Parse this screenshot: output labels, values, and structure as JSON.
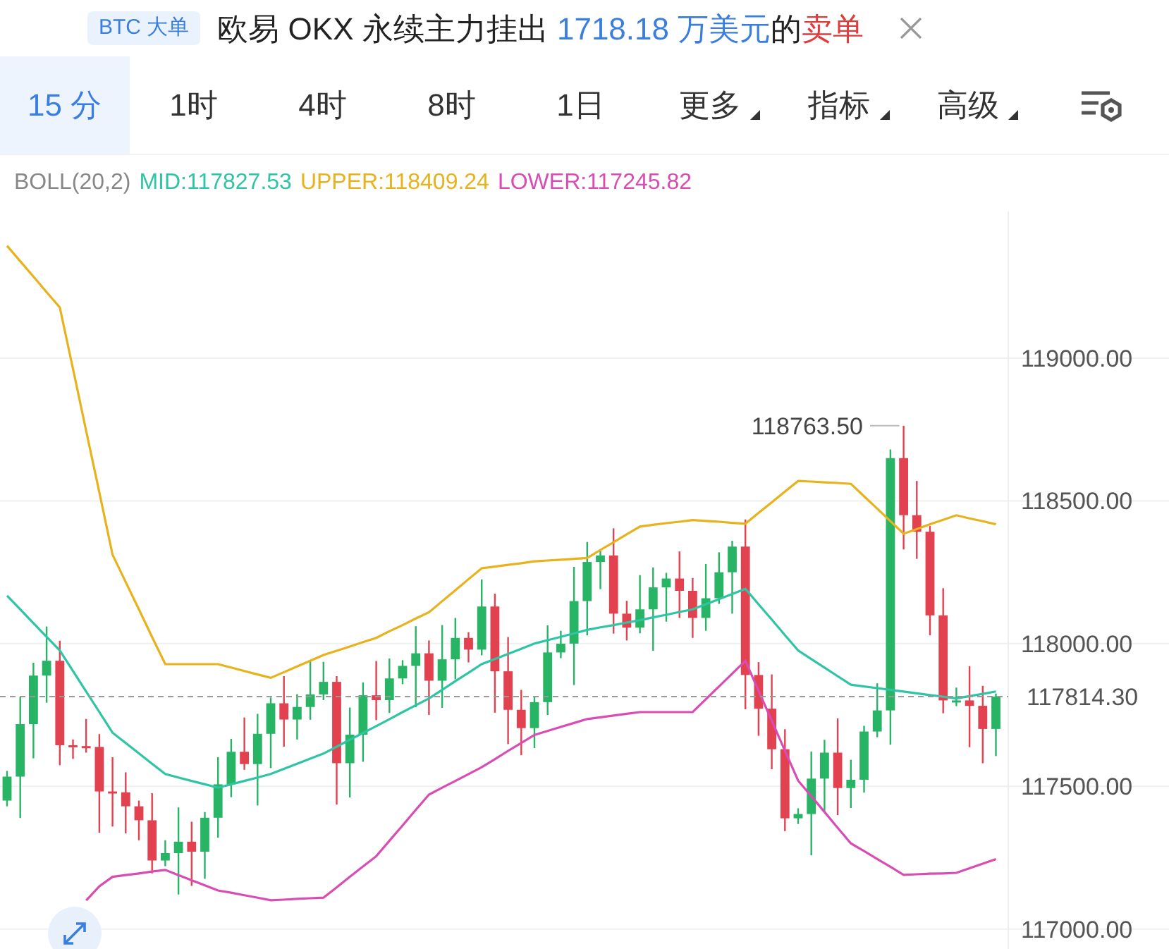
{
  "banner": {
    "tag": "BTC 大单",
    "message": [
      {
        "text": "欧易 OKX 永续主力挂出 ",
        "color": "#222222"
      },
      {
        "text": "1718.18 万美元",
        "color": "#3a7fe0"
      },
      {
        "text": "的",
        "color": "#222222"
      },
      {
        "text": "卖单",
        "color": "#e23b3b"
      }
    ]
  },
  "toolbar": {
    "tabs": [
      {
        "label": "15 分",
        "selected": true,
        "kind": "plain"
      },
      {
        "label": "1时",
        "selected": false,
        "kind": "plain"
      },
      {
        "label": "4时",
        "selected": false,
        "kind": "plain"
      },
      {
        "label": "8时",
        "selected": false,
        "kind": "plain"
      },
      {
        "label": "1日",
        "selected": false,
        "kind": "plain"
      },
      {
        "label": "更多",
        "selected": false,
        "kind": "dropdown"
      },
      {
        "label": "指标",
        "selected": false,
        "kind": "dropdown"
      },
      {
        "label": "高级",
        "selected": false,
        "kind": "dropdown"
      }
    ]
  },
  "indicator": {
    "name": "BOLL(20,2)",
    "mid": "MID:117827.53",
    "upper": "UPPER:118409.24",
    "lower": "LOWER:117245.82"
  },
  "chart": {
    "chart_data": {
      "type": "candlestick",
      "grid": true,
      "ylim": [
        116930,
        119514
      ],
      "yticks": [
        {
          "value": 119000,
          "label": "119000.00"
        },
        {
          "value": 118500,
          "label": "118500.00"
        },
        {
          "value": 118000,
          "label": "118000.00"
        },
        {
          "value": 117500,
          "label": "117500.00"
        },
        {
          "value": 117000,
          "label": "117000.00"
        }
      ],
      "ohlc": [
        [
          117450,
          117554,
          117430,
          117534
        ],
        [
          117534,
          117813,
          117389,
          117718
        ],
        [
          117718,
          117933,
          117598,
          117888
        ],
        [
          117888,
          118060,
          117793,
          117940
        ],
        [
          117940,
          118010,
          117574,
          117644
        ],
        [
          117644,
          117664,
          117596,
          117641
        ],
        [
          117641,
          117736,
          117618,
          117638
        ],
        [
          117638,
          117683,
          117337,
          117482
        ],
        [
          117482,
          117602,
          117359,
          117479
        ],
        [
          117479,
          117549,
          117335,
          117430
        ],
        [
          117430,
          117450,
          117311,
          117381
        ],
        [
          117381,
          117476,
          117195,
          117240
        ],
        [
          117240,
          117311,
          117220,
          117266
        ],
        [
          117266,
          117426,
          117121,
          117306
        ],
        [
          117306,
          117376,
          117151,
          117271
        ],
        [
          117271,
          117410,
          117176,
          117390
        ],
        [
          117390,
          117602,
          117320,
          117507
        ],
        [
          117507,
          117666,
          117462,
          117621
        ],
        [
          117621,
          117741,
          117558,
          117578
        ],
        [
          117578,
          117754,
          117433,
          117684
        ],
        [
          117684,
          117811,
          117564,
          117791
        ],
        [
          117791,
          117886,
          117639,
          117734
        ],
        [
          117734,
          117823,
          117664,
          117778
        ],
        [
          117778,
          117942,
          117733,
          117822
        ],
        [
          117822,
          117936,
          117802,
          117866
        ],
        [
          117866,
          117886,
          117436,
          117581
        ],
        [
          117581,
          117776,
          117461,
          117681
        ],
        [
          117681,
          117864,
          117586,
          117819
        ],
        [
          117819,
          117939,
          117732,
          117802
        ],
        [
          117802,
          117948,
          117757,
          117878
        ],
        [
          117878,
          117942,
          117858,
          117922
        ],
        [
          117922,
          118061,
          117777,
          117966
        ],
        [
          117966,
          118011,
          117750,
          117870
        ],
        [
          117870,
          118065,
          117775,
          117945
        ],
        [
          117945,
          118090,
          117875,
          118020
        ],
        [
          118020,
          118040,
          117934,
          117979
        ],
        [
          117979,
          118225,
          117959,
          118130
        ],
        [
          118130,
          118175,
          117758,
          117903
        ],
        [
          117903,
          118023,
          117648,
          117768
        ],
        [
          117768,
          117838,
          117609,
          117704
        ],
        [
          117704,
          117815,
          117634,
          117795
        ],
        [
          117795,
          118064,
          117750,
          117969
        ],
        [
          117969,
          118045,
          117949,
          118000
        ],
        [
          118000,
          118269,
          117855,
          118149
        ],
        [
          118149,
          118356,
          118029,
          118286
        ],
        [
          118286,
          118329,
          118191,
          118309
        ],
        [
          118309,
          118404,
          118035,
          118105
        ],
        [
          118105,
          118150,
          118011,
          118056
        ],
        [
          118056,
          118240,
          118036,
          118120
        ],
        [
          118120,
          118267,
          117975,
          118197
        ],
        [
          118197,
          118248,
          118077,
          118228
        ],
        [
          118228,
          118323,
          118090,
          118185
        ],
        [
          118185,
          118230,
          118020,
          118090
        ],
        [
          118090,
          118279,
          118045,
          118159
        ],
        [
          118159,
          118320,
          118139,
          118250
        ],
        [
          118250,
          118360,
          118105,
          118340
        ],
        [
          118340,
          118435,
          117770,
          117890
        ],
        [
          117890,
          117935,
          117677,
          117772
        ],
        [
          117772,
          117892,
          117560,
          117630
        ],
        [
          117630,
          117700,
          117343,
          117388
        ],
        [
          117388,
          117423,
          117368,
          117403
        ],
        [
          117403,
          117622,
          117258,
          117527
        ],
        [
          117527,
          117663,
          117407,
          117618
        ],
        [
          117618,
          117738,
          117399,
          117494
        ],
        [
          117494,
          117593,
          117424,
          117523
        ],
        [
          117523,
          117712,
          117478,
          117692
        ],
        [
          117692,
          117861,
          117672,
          117766
        ],
        [
          117766,
          118680,
          117646,
          118650
        ],
        [
          118650,
          118763.5,
          118330,
          118450
        ],
        [
          118450,
          118570,
          118297,
          118392
        ],
        [
          118392,
          118412,
          118029,
          118099
        ],
        [
          118099,
          118194,
          117756,
          117801
        ],
        [
          117801,
          117846,
          117781,
          117801
        ],
        [
          117801,
          117921,
          117637,
          117782
        ],
        [
          117782,
          117852,
          117581,
          117701
        ],
        [
          117701,
          117825,
          117606,
          117814.3
        ]
      ],
      "series": [
        {
          "type": "line",
          "color": "#2fc4a4",
          "values": [
            118168,
            118120,
            118072,
            118024,
            117976,
            117904,
            117832,
            117760,
            117688,
            117652,
            117616,
            117579,
            117543,
            117531,
            117519,
            117507,
            117495,
            117507,
            117519,
            117531,
            117543,
            117561,
            117579,
            117597,
            117615,
            117639,
            117663,
            117687,
            117711,
            117735,
            117760,
            117784,
            117808,
            117838,
            117868,
            117898,
            117928,
            117946,
            117964,
            117982,
            118000,
            118012,
            118024,
            118036,
            118048,
            118057,
            118065,
            118074,
            118082,
            118092,
            118101,
            118111,
            118120,
            118138,
            118156,
            118174,
            118192,
            118138,
            118084,
            118030,
            117976,
            117946,
            117916,
            117886,
            117856,
            117850,
            117844,
            117838,
            117832,
            117826,
            117820,
            117814,
            117808,
            117816,
            117824,
            117832
          ]
        },
        {
          "type": "line",
          "color": "#e8b21c",
          "values": [
            119394,
            119340,
            119286,
            119232,
            119178,
            118962,
            118745,
            118529,
            118312,
            118216,
            118120,
            118024,
            117928,
            117928,
            117928,
            117928,
            117928,
            117916,
            117904,
            117892,
            117880,
            117900,
            117920,
            117940,
            117960,
            117975,
            117990,
            118005,
            118020,
            118043,
            118065,
            118088,
            118110,
            118149,
            118187,
            118226,
            118264,
            118270,
            118276,
            118282,
            118288,
            118291,
            118294,
            118297,
            118300,
            118328,
            118355,
            118383,
            118410,
            118416,
            118422,
            118427,
            118433,
            118430,
            118427,
            118423,
            118420,
            118458,
            118495,
            118533,
            118570,
            118568,
            118565,
            118563,
            118560,
            118516,
            118473,
            118429,
            118385,
            118401,
            118418,
            118434,
            118450,
            118439,
            118429,
            118418
          ]
        },
        {
          "type": "line",
          "color": "#d84cb3",
          "values": [
            null,
            null,
            null,
            null,
            null,
            null,
            117100,
            117150,
            117183,
            117189,
            117195,
            117201,
            117207,
            117189,
            117171,
            117153,
            117135,
            117127,
            117118,
            117110,
            117101,
            117103,
            117106,
            117108,
            117110,
            117146,
            117183,
            117219,
            117255,
            117309,
            117363,
            117417,
            117471,
            117495,
            117519,
            117543,
            117567,
            117595,
            117624,
            117652,
            117680,
            117694,
            117708,
            117722,
            117736,
            117742,
            117748,
            117754,
            117760,
            117760,
            117760,
            117760,
            117760,
            117805,
            117850,
            117895,
            117940,
            117835,
            117730,
            117625,
            117520,
            117465,
            117410,
            117355,
            117300,
            117273,
            117245,
            117218,
            117190,
            117192,
            117194,
            117195,
            117197,
            117213,
            117229,
            117245
          ]
        }
      ],
      "ref_lines": [
        {
          "axis": "y",
          "value": 117814.3,
          "label": "117814.30"
        }
      ],
      "annotations": [
        "118763.50"
      ]
    }
  }
}
